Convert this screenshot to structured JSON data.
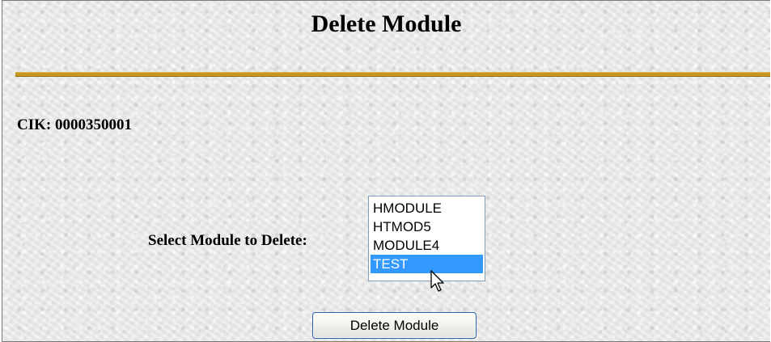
{
  "page": {
    "title": "Delete Module"
  },
  "cik": {
    "text": "CIK: 0000350001"
  },
  "select": {
    "label": "Select Module to Delete:",
    "options": [
      "HMODULE",
      "HTMOD5",
      "MODULE4",
      "TEST"
    ],
    "selected": "TEST"
  },
  "actions": {
    "delete_label": "Delete Module"
  },
  "colors": {
    "rule": "#c8961e",
    "selection": "#3399ff",
    "button_border": "#2a5ea6"
  },
  "icons": {
    "cursor": "arrow-pointer-icon"
  }
}
